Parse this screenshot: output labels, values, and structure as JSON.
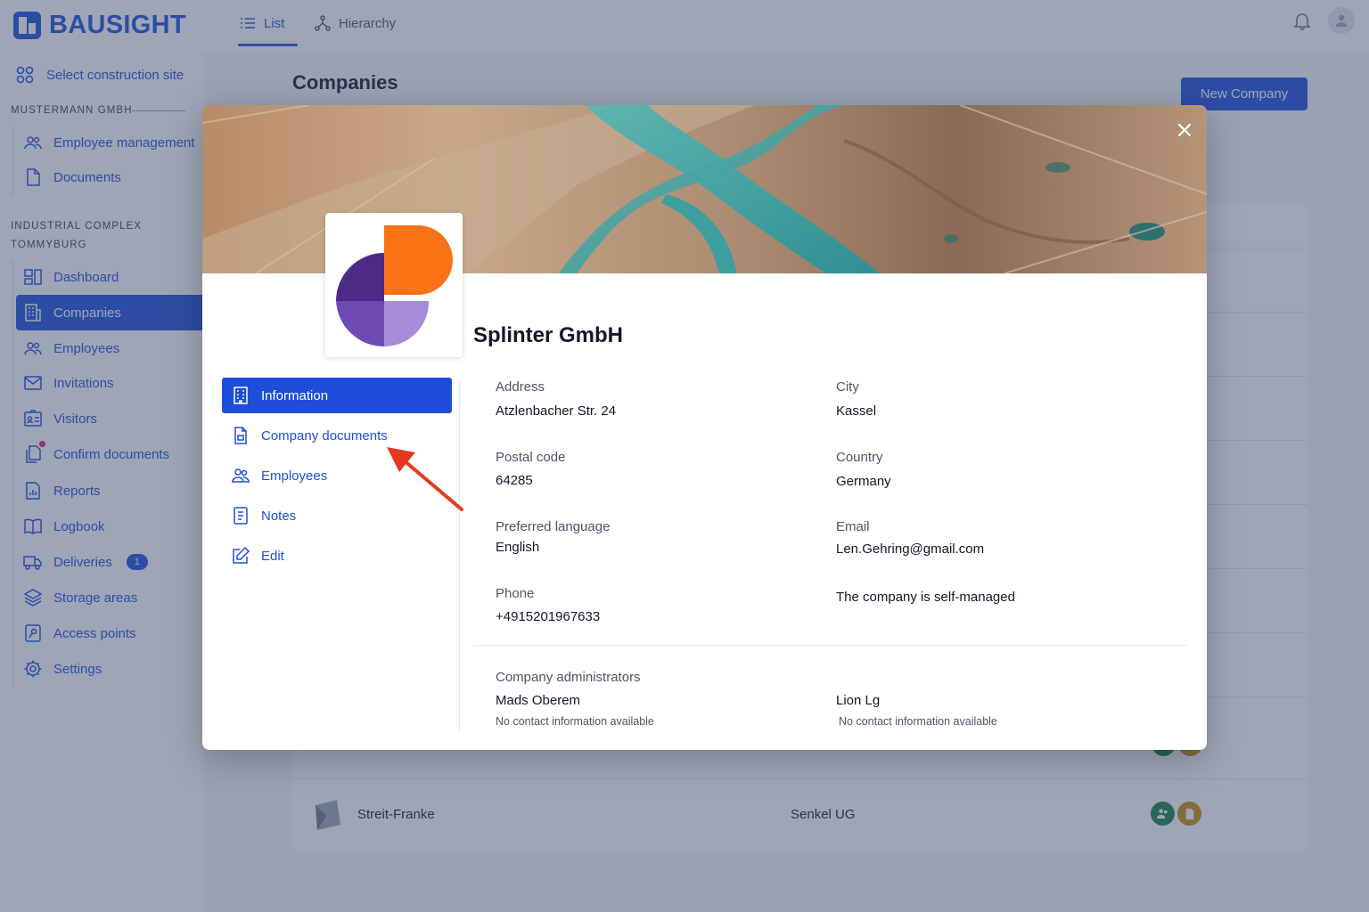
{
  "app": {
    "brand": "BAUSIGHT"
  },
  "sidebar": {
    "select_site": "Select construction site",
    "org_section": "MUSTERMANN GMBH",
    "org_items": [
      {
        "label": "Employee management",
        "icon": "users-icon"
      },
      {
        "label": "Documents",
        "icon": "document-icon"
      }
    ],
    "site_section_line1": "INDUSTRIAL COMPLEX",
    "site_section_line2": "TOMMYBURG",
    "site_items": [
      {
        "label": "Dashboard",
        "icon": "dashboard-icon"
      },
      {
        "label": "Companies",
        "icon": "building-icon",
        "active": true
      },
      {
        "label": "Employees",
        "icon": "users-icon"
      },
      {
        "label": "Invitations",
        "icon": "envelope-icon"
      },
      {
        "label": "Visitors",
        "icon": "id-card-icon"
      },
      {
        "label": "Confirm documents",
        "icon": "documents-icon",
        "notification_dot": true
      },
      {
        "label": "Reports",
        "icon": "report-icon"
      },
      {
        "label": "Logbook",
        "icon": "book-icon"
      },
      {
        "label": "Deliveries",
        "icon": "truck-icon",
        "badge": "1"
      },
      {
        "label": "Storage areas",
        "icon": "layers-icon"
      },
      {
        "label": "Access points",
        "icon": "access-icon"
      },
      {
        "label": "Settings",
        "icon": "gear-icon"
      }
    ]
  },
  "topbar": {
    "tabs": [
      {
        "label": "List",
        "icon": "list-icon",
        "active": true
      },
      {
        "label": "Hierarchy",
        "icon": "hierarchy-icon"
      }
    ]
  },
  "page": {
    "title": "Companies",
    "new_company_label": "New Company",
    "visible_row": {
      "name": "Streit-Franke",
      "parent": "Senkel UG"
    }
  },
  "modal": {
    "company_name": "Splinter GmbH",
    "menu": [
      {
        "label": "Information",
        "icon": "building-icon",
        "active": true
      },
      {
        "label": "Company documents",
        "icon": "file-icon"
      },
      {
        "label": "Employees",
        "icon": "users-icon"
      },
      {
        "label": "Notes",
        "icon": "notes-icon"
      },
      {
        "label": "Edit",
        "icon": "edit-icon"
      }
    ],
    "fields": {
      "address_label": "Address",
      "address_value": "Atzlenbacher Str. 24",
      "city_label": "City",
      "city_value": "Kassel",
      "postal_label": "Postal code",
      "postal_value": "64285",
      "country_label": "Country",
      "country_value": "Germany",
      "language_label": "Preferred language",
      "language_value": "English",
      "email_label": "Email",
      "email_value": "Len.Gehring@gmail.com",
      "phone_label": "Phone",
      "phone_value": "+4915201967633",
      "self_managed": "The company is self-managed"
    },
    "admins": {
      "label": "Company administrators",
      "list": [
        {
          "name": "Mads Oberem",
          "note": "No contact information available"
        },
        {
          "name": "Lion Lg",
          "note": "No contact information available"
        }
      ]
    }
  },
  "colors": {
    "brand_blue": "#1d4ed8",
    "overlay": "#3e4c70",
    "logo_orange": "#f97316",
    "logo_purple_dark": "#4c2a85",
    "logo_purple_mid": "#6d4bb3",
    "logo_purple_light": "#a78bdb",
    "annotation_arrow": "#e5391f"
  }
}
